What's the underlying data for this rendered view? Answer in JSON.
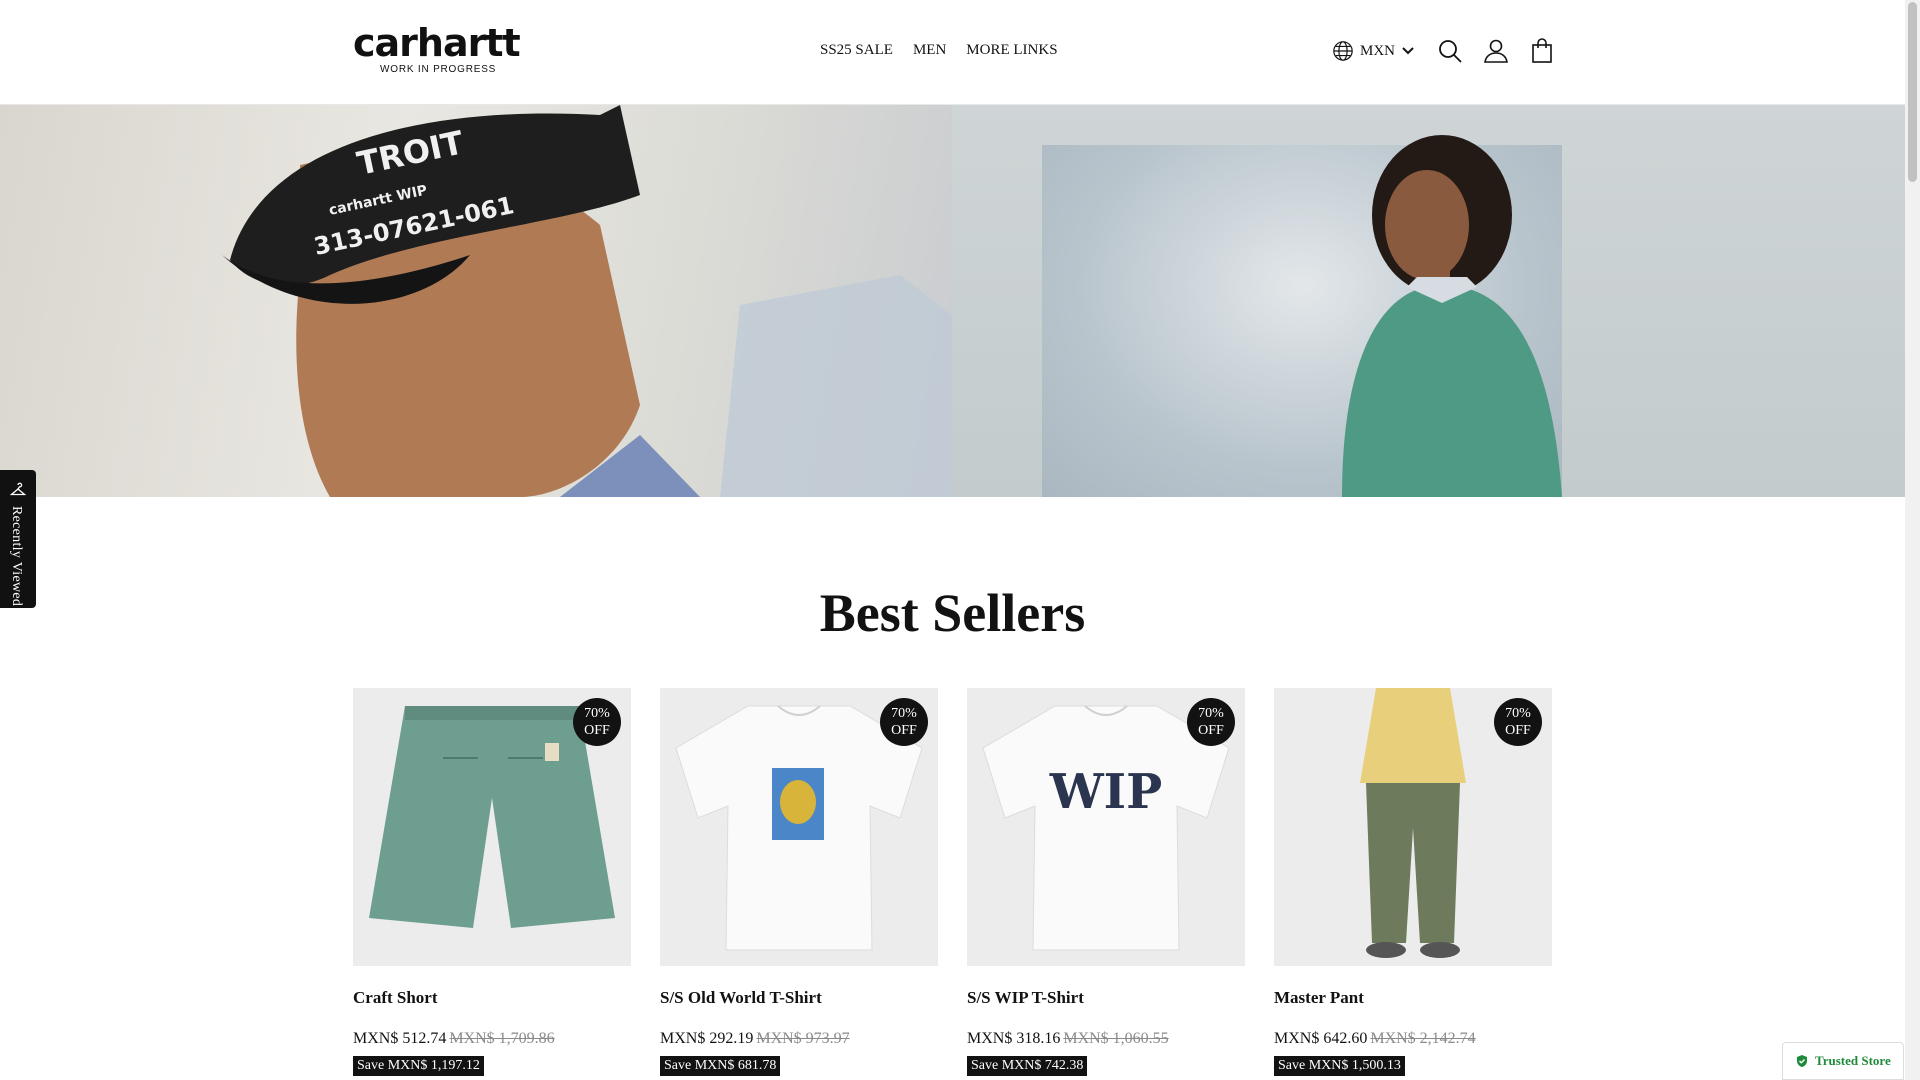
{
  "header": {
    "logo_text": "carhartt",
    "logo_sub": "WORK IN PROGRESS",
    "nav": [
      {
        "label": "SS25 SALE"
      },
      {
        "label": "MEN"
      },
      {
        "label": "MORE LINKS"
      }
    ],
    "currency": "MXN",
    "icons": [
      "globe-icon",
      "chevron-down-icon",
      "search-icon",
      "account-icon",
      "cart-icon"
    ]
  },
  "recently_viewed": {
    "label": "Recently Viewed",
    "icon": "hanger-icon"
  },
  "section": {
    "title": "Best Sellers"
  },
  "products": [
    {
      "name": "Craft Short",
      "badge_line1": "70%",
      "badge_line2": "OFF",
      "price": "MXN$ 512.74",
      "compare_price": "MXN$ 1,709.86",
      "save": "Save MXN$ 1,197.12"
    },
    {
      "name": "S/S Old World T-Shirt",
      "badge_line1": "70%",
      "badge_line2": "OFF",
      "price": "MXN$ 292.19",
      "compare_price": "MXN$ 973.97",
      "save": "Save MXN$ 681.78"
    },
    {
      "name": "S/S WIP T-Shirt",
      "badge_line1": "70%",
      "badge_line2": "OFF",
      "price": "MXN$ 318.16",
      "compare_price": "MXN$ 1,060.55",
      "save": "Save MXN$ 742.38"
    },
    {
      "name": "Master Pant",
      "badge_line1": "70%",
      "badge_line2": "OFF",
      "price": "MXN$ 642.60",
      "compare_price": "MXN$ 2,142.74",
      "save": "Save MXN$ 1,500.13"
    }
  ],
  "trusted_store": {
    "label": "Trusted Store"
  },
  "colors": {
    "accent": "#121212",
    "trusted_green": "#1f8a3a",
    "short_green": "#6e9e90",
    "pant_olive": "#6d7a5c"
  }
}
